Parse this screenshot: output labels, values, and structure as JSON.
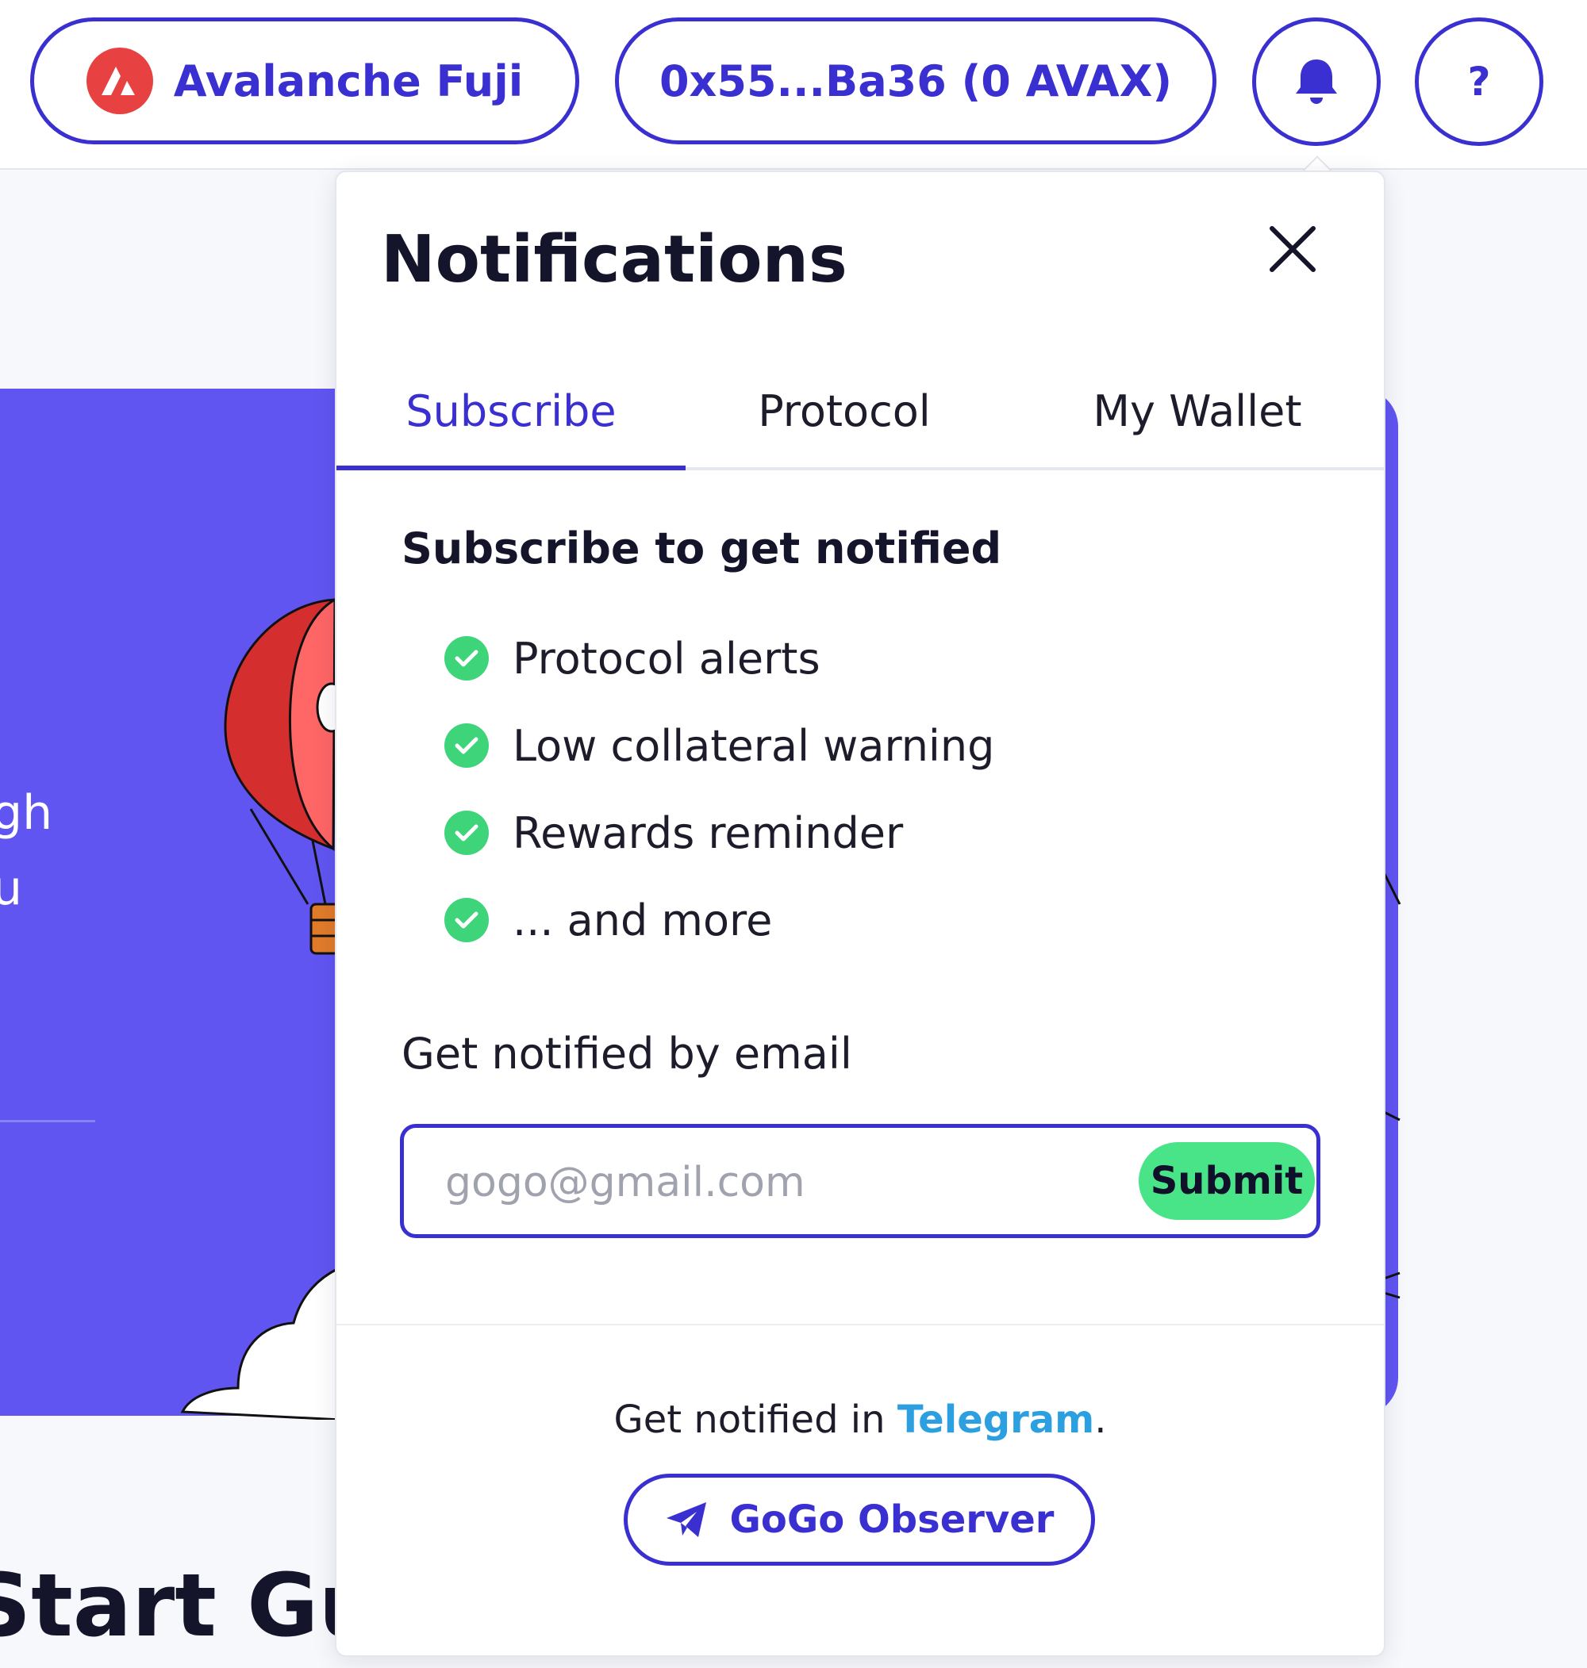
{
  "topbar": {
    "network_label": "Avalanche Fuji",
    "wallet_label": "0x55...Ba36 (0 AVAX)",
    "help_label": "?"
  },
  "background": {
    "hero_fragment_1": "gh",
    "hero_fragment_2": "u",
    "guide_title": "Start Gui"
  },
  "notifications": {
    "title": "Notifications",
    "tabs": [
      {
        "label": "Subscribe",
        "active": true
      },
      {
        "label": "Protocol",
        "active": false
      },
      {
        "label": "My Wallet",
        "active": false
      }
    ],
    "section_title": "Subscribe to get notified",
    "features": [
      "Protocol alerts",
      "Low collateral warning",
      "Rewards reminder",
      "... and more"
    ],
    "email": {
      "label": "Get notified by email",
      "placeholder": "gogo@gmail.com",
      "value": "",
      "submit_label": "Submit"
    },
    "telegram": {
      "prefix": "Get notified in ",
      "link_label": "Telegram",
      "suffix": ".",
      "button_label": "GoGo Observer"
    }
  },
  "colors": {
    "accent": "#3a2fd0",
    "hero": "#6155f1",
    "success": "#3ed47a",
    "submit": "#49e488",
    "telegram": "#2c9fe0",
    "avalanche": "#e84142"
  },
  "icons": {
    "network": "avalanche-logo-icon",
    "bell": "bell-icon",
    "close": "close-icon",
    "check": "check-circle-icon",
    "telegram": "telegram-plane-icon"
  }
}
